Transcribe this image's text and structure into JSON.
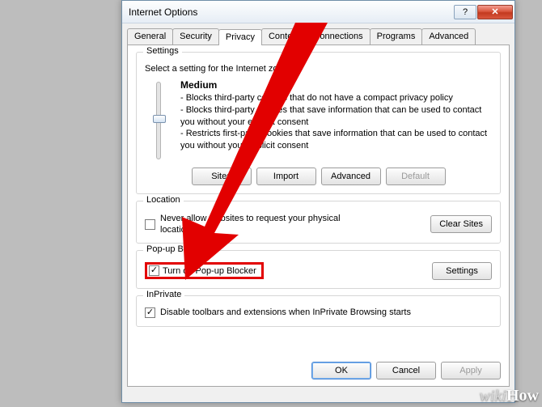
{
  "window": {
    "title": "Internet Options"
  },
  "tabs": {
    "items": [
      {
        "label": "General"
      },
      {
        "label": "Security"
      },
      {
        "label": "Privacy"
      },
      {
        "label": "Content"
      },
      {
        "label": "Connections"
      },
      {
        "label": "Programs"
      },
      {
        "label": "Advanced"
      }
    ],
    "active_index": 2
  },
  "settings_group": {
    "label": "Settings",
    "intro": "Select a setting for the Internet zone.",
    "level_name": "Medium",
    "bullets": [
      "- Blocks third-party cookies that do not have a compact privacy policy",
      "- Blocks third-party cookies that save information that can be used to contact you without your explicit consent",
      "- Restricts first-party cookies that save information that can be used to contact you without your implicit consent"
    ],
    "buttons": {
      "sites": "Sites",
      "import": "Import",
      "advanced": "Advanced",
      "default": "Default"
    }
  },
  "location_group": {
    "label": "Location",
    "checkbox_label": "Never allow websites to request your physical location",
    "checked": false,
    "clear_btn": "Clear Sites"
  },
  "popup_group": {
    "label": "Pop-up Blocker",
    "checkbox_label": "Turn on Pop-up Blocker",
    "checked": true,
    "settings_btn": "Settings"
  },
  "inprivate_group": {
    "label": "InPrivate",
    "checkbox_label": "Disable toolbars and extensions when InPrivate Browsing starts",
    "checked": true
  },
  "dialog_buttons": {
    "ok": "OK",
    "cancel": "Cancel",
    "apply": "Apply"
  },
  "watermark": {
    "wiki": "wiki",
    "how": "How"
  }
}
